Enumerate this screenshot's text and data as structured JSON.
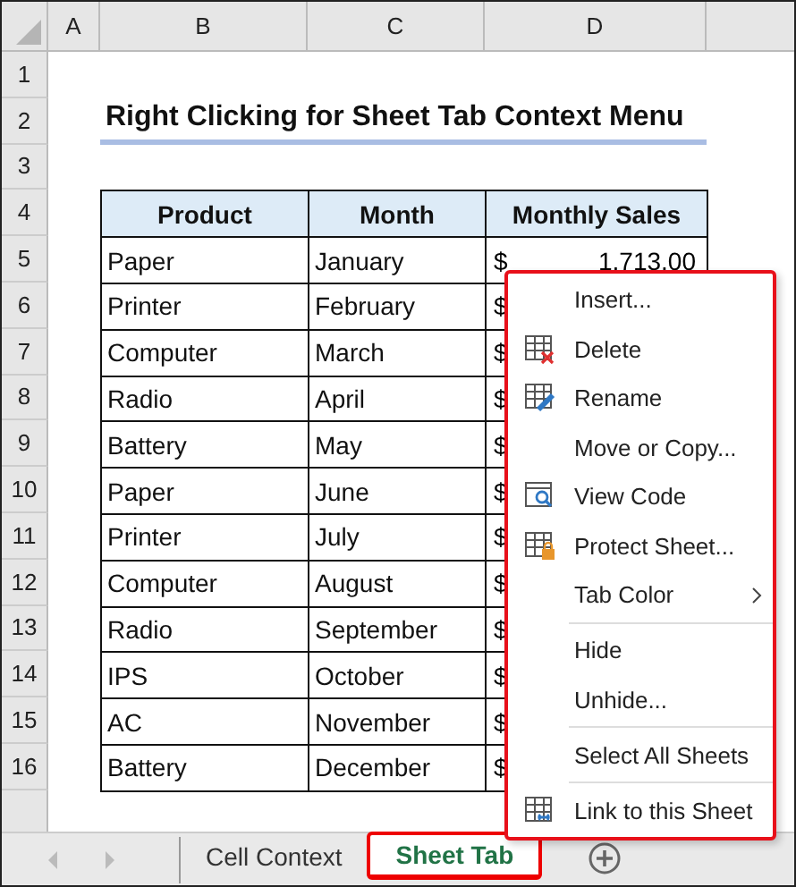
{
  "column_headers": [
    "A",
    "B",
    "C",
    "D"
  ],
  "row_numbers": [
    "1",
    "2",
    "3",
    "4",
    "5",
    "6",
    "7",
    "8",
    "9",
    "10",
    "11",
    "12",
    "13",
    "14",
    "15",
    "16"
  ],
  "title": "Right Clicking for Sheet Tab Context Menu",
  "table": {
    "columns": [
      "Product",
      "Month",
      "Monthly Sales"
    ],
    "rows": [
      {
        "product": "Paper",
        "month": "January",
        "currency": "$",
        "amount": "1,713.00"
      },
      {
        "product": "Printer",
        "month": "February",
        "currency": "$"
      },
      {
        "product": "Computer",
        "month": "March",
        "currency": "$"
      },
      {
        "product": "Radio",
        "month": "April",
        "currency": "$"
      },
      {
        "product": "Battery",
        "month": "May",
        "currency": "$"
      },
      {
        "product": "Paper",
        "month": "June",
        "currency": "$"
      },
      {
        "product": "Printer",
        "month": "July",
        "currency": "$"
      },
      {
        "product": "Computer",
        "month": "August",
        "currency": "$"
      },
      {
        "product": "Radio",
        "month": "September",
        "currency": "$"
      },
      {
        "product": "IPS",
        "month": "October",
        "currency": "$"
      },
      {
        "product": "AC",
        "month": "November",
        "currency": "$"
      },
      {
        "product": "Battery",
        "month": "December",
        "currency": "$"
      }
    ]
  },
  "context_menu": {
    "items": [
      {
        "label": "Insert...",
        "kind": "none",
        "separator_before": false,
        "submenu": false
      },
      {
        "label": "Delete",
        "kind": "delete",
        "separator_before": false,
        "submenu": false
      },
      {
        "label": "Rename",
        "kind": "rename",
        "separator_before": false,
        "submenu": false
      },
      {
        "label": "Move or Copy...",
        "kind": "none",
        "separator_before": false,
        "submenu": false
      },
      {
        "label": "View Code",
        "kind": "code",
        "separator_before": false,
        "submenu": false
      },
      {
        "label": "Protect Sheet...",
        "kind": "protect",
        "separator_before": false,
        "submenu": false
      },
      {
        "label": "Tab Color",
        "kind": "none",
        "separator_before": false,
        "submenu": true
      },
      {
        "label": "Hide",
        "kind": "none",
        "separator_before": true,
        "submenu": false
      },
      {
        "label": "Unhide...",
        "kind": "none",
        "separator_before": false,
        "submenu": false
      },
      {
        "label": "Select All Sheets",
        "kind": "none",
        "separator_before": true,
        "submenu": false
      },
      {
        "label": "Link to this Sheet",
        "kind": "link",
        "separator_before": true,
        "submenu": false
      }
    ]
  },
  "sheet_tabs": [
    {
      "label": "Cell Context",
      "selected": false
    },
    {
      "label": "Sheet Tab",
      "selected": true
    }
  ]
}
